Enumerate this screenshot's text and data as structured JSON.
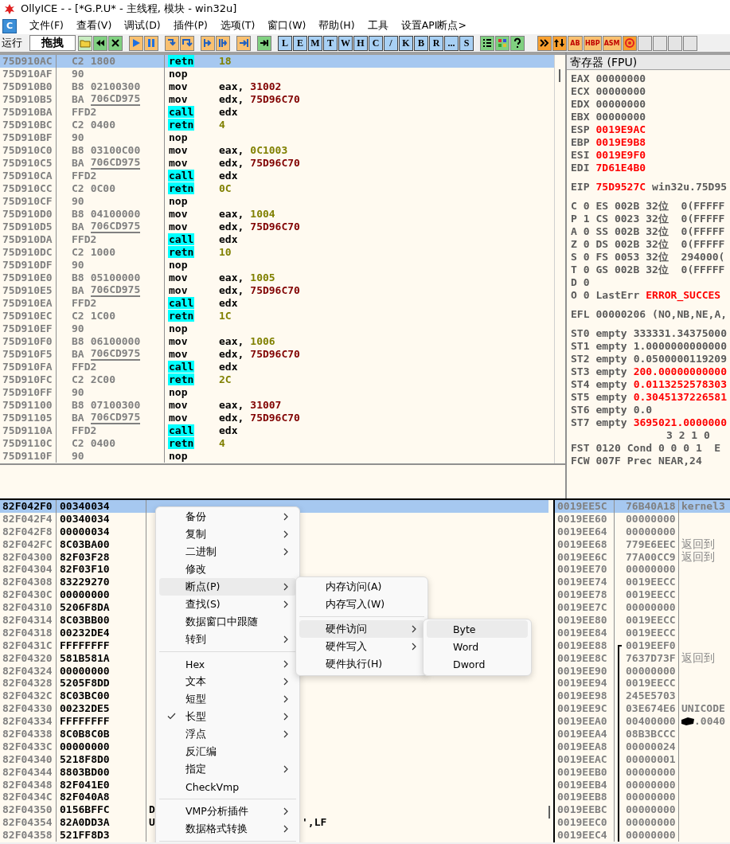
{
  "window": {
    "title": "OllyICE - - [*G.P.U* - 主线程, 模块 - win32u]"
  },
  "menu_bar": {
    "icon_letter": "C",
    "items": [
      "文件(F)",
      "查看(V)",
      "调试(D)",
      "插件(P)",
      "选项(T)",
      "窗口(W)",
      "帮助(H)",
      "工具",
      "设置API断点>"
    ]
  },
  "toolbar": {
    "run_label": "运行",
    "drag_button": "拖拽",
    "letter_buttons": [
      "L",
      "E",
      "M",
      "T",
      "W",
      "H",
      "C",
      "/",
      "K",
      "B",
      "R",
      "...",
      "S"
    ],
    "text_icons": [
      "AB",
      "HBP",
      "ASM"
    ]
  },
  "disassembly": {
    "rows": [
      {
        "address": "75D910AC",
        "hex": [
          "C2",
          "1800"
        ],
        "fixup": false,
        "kind": "retn",
        "mnemonic": "retn",
        "operand": "18",
        "color": "#808000",
        "selected": true
      },
      {
        "address": "75D910AF",
        "hex": [
          "90"
        ],
        "fixup": false,
        "kind": "plain",
        "mnemonic": "nop",
        "selected": false
      },
      {
        "address": "75D910B0",
        "hex": [
          "B8",
          "02100300"
        ],
        "fixup": false,
        "kind": "plain",
        "mnemonic": "mov",
        "register": "eax,",
        "operand": "31002",
        "color": "#800000",
        "selected": false
      },
      {
        "address": "75D910B5",
        "hex": [
          "BA",
          "706CD975"
        ],
        "fixup": true,
        "kind": "plain",
        "mnemonic": "mov",
        "register": "edx,",
        "operand": "75D96C70",
        "color": "#800000",
        "selected": false
      },
      {
        "address": "75D910BA",
        "hex": [
          "FFD2"
        ],
        "fixup": false,
        "kind": "call",
        "mnemonic": "call",
        "operand": "edx",
        "color": "#000000",
        "selected": false
      },
      {
        "address": "75D910BC",
        "hex": [
          "C2",
          "0400"
        ],
        "fixup": false,
        "kind": "retn",
        "mnemonic": "retn",
        "operand": "4",
        "color": "#808000",
        "selected": false
      },
      {
        "address": "75D910BF",
        "hex": [
          "90"
        ],
        "fixup": false,
        "kind": "plain",
        "mnemonic": "nop",
        "selected": false
      },
      {
        "address": "75D910C0",
        "hex": [
          "B8",
          "03100C00"
        ],
        "fixup": false,
        "kind": "plain",
        "mnemonic": "mov",
        "register": "eax,",
        "operand": "0C1003",
        "color": "#808000",
        "selected": false
      },
      {
        "address": "75D910C5",
        "hex": [
          "BA",
          "706CD975"
        ],
        "fixup": true,
        "kind": "plain",
        "mnemonic": "mov",
        "register": "edx,",
        "operand": "75D96C70",
        "color": "#800000",
        "selected": false
      },
      {
        "address": "75D910CA",
        "hex": [
          "FFD2"
        ],
        "fixup": false,
        "kind": "call",
        "mnemonic": "call",
        "operand": "edx",
        "color": "#000000",
        "selected": false
      },
      {
        "address": "75D910CC",
        "hex": [
          "C2",
          "0C00"
        ],
        "fixup": false,
        "kind": "retn",
        "mnemonic": "retn",
        "operand": "0C",
        "color": "#808000",
        "selected": false
      },
      {
        "address": "75D910CF",
        "hex": [
          "90"
        ],
        "fixup": false,
        "kind": "plain",
        "mnemonic": "nop",
        "selected": false
      },
      {
        "address": "75D910D0",
        "hex": [
          "B8",
          "04100000"
        ],
        "fixup": false,
        "kind": "plain",
        "mnemonic": "mov",
        "register": "eax,",
        "operand": "1004",
        "color": "#808000",
        "selected": false
      },
      {
        "address": "75D910D5",
        "hex": [
          "BA",
          "706CD975"
        ],
        "fixup": true,
        "kind": "plain",
        "mnemonic": "mov",
        "register": "edx,",
        "operand": "75D96C70",
        "color": "#800000",
        "selected": false
      },
      {
        "address": "75D910DA",
        "hex": [
          "FFD2"
        ],
        "fixup": false,
        "kind": "call",
        "mnemonic": "call",
        "operand": "edx",
        "color": "#000000",
        "selected": false
      },
      {
        "address": "75D910DC",
        "hex": [
          "C2",
          "1000"
        ],
        "fixup": false,
        "kind": "retn",
        "mnemonic": "retn",
        "operand": "10",
        "color": "#808000",
        "selected": false
      },
      {
        "address": "75D910DF",
        "hex": [
          "90"
        ],
        "fixup": false,
        "kind": "plain",
        "mnemonic": "nop",
        "selected": false
      },
      {
        "address": "75D910E0",
        "hex": [
          "B8",
          "05100000"
        ],
        "fixup": false,
        "kind": "plain",
        "mnemonic": "mov",
        "register": "eax,",
        "operand": "1005",
        "color": "#808000",
        "selected": false
      },
      {
        "address": "75D910E5",
        "hex": [
          "BA",
          "706CD975"
        ],
        "fixup": true,
        "kind": "plain",
        "mnemonic": "mov",
        "register": "edx,",
        "operand": "75D96C70",
        "color": "#800000",
        "selected": false
      },
      {
        "address": "75D910EA",
        "hex": [
          "FFD2"
        ],
        "fixup": false,
        "kind": "call",
        "mnemonic": "call",
        "operand": "edx",
        "color": "#000000",
        "selected": false
      },
      {
        "address": "75D910EC",
        "hex": [
          "C2",
          "1C00"
        ],
        "fixup": false,
        "kind": "retn",
        "mnemonic": "retn",
        "operand": "1C",
        "color": "#808000",
        "selected": false
      },
      {
        "address": "75D910EF",
        "hex": [
          "90"
        ],
        "fixup": false,
        "kind": "plain",
        "mnemonic": "nop",
        "selected": false
      },
      {
        "address": "75D910F0",
        "hex": [
          "B8",
          "06100000"
        ],
        "fixup": false,
        "kind": "plain",
        "mnemonic": "mov",
        "register": "eax,",
        "operand": "1006",
        "color": "#808000",
        "selected": false
      },
      {
        "address": "75D910F5",
        "hex": [
          "BA",
          "706CD975"
        ],
        "fixup": true,
        "kind": "plain",
        "mnemonic": "mov",
        "register": "edx,",
        "operand": "75D96C70",
        "color": "#800000",
        "selected": false
      },
      {
        "address": "75D910FA",
        "hex": [
          "FFD2"
        ],
        "fixup": false,
        "kind": "call",
        "mnemonic": "call",
        "operand": "edx",
        "color": "#000000",
        "selected": false
      },
      {
        "address": "75D910FC",
        "hex": [
          "C2",
          "2C00"
        ],
        "fixup": false,
        "kind": "retn",
        "mnemonic": "retn",
        "operand": "2C",
        "color": "#808000",
        "selected": false
      },
      {
        "address": "75D910FF",
        "hex": [
          "90"
        ],
        "fixup": false,
        "kind": "plain",
        "mnemonic": "nop",
        "selected": false
      },
      {
        "address": "75D91100",
        "hex": [
          "B8",
          "07100300"
        ],
        "fixup": false,
        "kind": "plain",
        "mnemonic": "mov",
        "register": "eax,",
        "operand": "31007",
        "color": "#800000",
        "selected": false
      },
      {
        "address": "75D91105",
        "hex": [
          "BA",
          "706CD975"
        ],
        "fixup": true,
        "kind": "plain",
        "mnemonic": "mov",
        "register": "edx,",
        "operand": "75D96C70",
        "color": "#800000",
        "selected": false
      },
      {
        "address": "75D9110A",
        "hex": [
          "FFD2"
        ],
        "fixup": false,
        "kind": "call",
        "mnemonic": "call",
        "operand": "edx",
        "color": "#000000",
        "selected": false
      },
      {
        "address": "75D9110C",
        "hex": [
          "C2",
          "0400"
        ],
        "fixup": false,
        "kind": "retn",
        "mnemonic": "retn",
        "operand": "4",
        "color": "#808000",
        "selected": false
      },
      {
        "address": "75D9110F",
        "hex": [
          "90"
        ],
        "fixup": false,
        "kind": "plain",
        "mnemonic": "nop",
        "selected": false
      }
    ]
  },
  "registers": {
    "title": "寄存器 (FPU)",
    "groups": [
      {
        "rows": [
          {
            "kind": "reg",
            "name": "EAX",
            "value": "00000000",
            "changed": false
          },
          {
            "kind": "reg",
            "name": "ECX",
            "value": "00000000",
            "changed": false
          },
          {
            "kind": "reg",
            "name": "EDX",
            "value": "00000000",
            "changed": false
          },
          {
            "kind": "reg",
            "name": "EBX",
            "value": "00000000",
            "changed": false
          },
          {
            "kind": "reg",
            "name": "ESP",
            "value": "0019E9AC",
            "changed": true
          },
          {
            "kind": "reg",
            "name": "EBP",
            "value": "0019E9B8",
            "changed": true
          },
          {
            "kind": "reg",
            "name": "ESI",
            "value": "0019E9F0",
            "changed": true
          },
          {
            "kind": "reg",
            "name": "EDI",
            "value": "7D61E4B0",
            "changed": true
          }
        ]
      },
      {
        "rows": [
          {
            "kind": "reg",
            "name": "EIP",
            "value": "75D9527C",
            "changed": true,
            "note": "win32u.75D95",
            "note_changed": false
          }
        ]
      },
      {
        "rows": [
          {
            "kind": "reg",
            "name": "C 0",
            "value": "ES 002B",
            "changed": false,
            "note": "32位  0(FFFFF",
            "note_changed": false
          },
          {
            "kind": "reg",
            "name": "P 1",
            "value": "CS 0023",
            "changed": false,
            "note": "32位  0(FFFFF",
            "note_changed": false
          },
          {
            "kind": "reg",
            "name": "A 0",
            "value": "SS 002B",
            "changed": false,
            "note": "32位  0(FFFFF",
            "note_changed": false
          },
          {
            "kind": "reg",
            "name": "Z 0",
            "value": "DS 002B",
            "changed": false,
            "note": "32位  0(FFFFF",
            "note_changed": false
          },
          {
            "kind": "reg",
            "name": "S 0",
            "value": "FS 0053",
            "changed": false,
            "note": "32位  294000(",
            "note_changed": false
          },
          {
            "kind": "reg",
            "name": "T 0",
            "value": "GS 002B",
            "changed": false,
            "note": "32位  0(FFFFF",
            "note_changed": false
          },
          {
            "kind": "reg",
            "name": "D 0"
          },
          {
            "kind": "reg",
            "name": "O 0",
            "value": "LastErr",
            "changed": false,
            "note": "ERROR_SUCCES",
            "note_changed": true
          }
        ]
      },
      {
        "rows": [
          {
            "kind": "reg",
            "name": "EFL",
            "value": "00000206",
            "changed": false,
            "note": "(NO,NB,NE,A,",
            "note_changed": false
          }
        ]
      },
      {
        "rows": [
          {
            "kind": "reg",
            "name": "ST0",
            "value": "empty",
            "changed": false,
            "note": "333331.34375000",
            "note_changed": false
          },
          {
            "kind": "reg",
            "name": "ST1",
            "value": "empty",
            "changed": false,
            "note": "1.0000000000000",
            "note_changed": false
          },
          {
            "kind": "reg",
            "name": "ST2",
            "value": "empty",
            "changed": false,
            "note": "0.0500000119209",
            "note_changed": false
          },
          {
            "kind": "reg",
            "name": "ST3",
            "value": "empty",
            "changed": false,
            "note": "200.00000000000",
            "note_changed": true
          },
          {
            "kind": "reg",
            "name": "ST4",
            "value": "empty",
            "changed": false,
            "note": "0.0113252578303",
            "note_changed": true
          },
          {
            "kind": "reg",
            "name": "ST5",
            "value": "empty",
            "changed": false,
            "note": "0.3045137226581",
            "note_changed": true
          },
          {
            "kind": "reg",
            "name": "ST6",
            "value": "empty",
            "changed": false,
            "note": "0.0",
            "note_changed": false
          },
          {
            "kind": "reg",
            "name": "ST7",
            "value": "empty",
            "changed": false,
            "note": "3695021.0000000",
            "note_changed": true
          },
          {
            "kind": "digits",
            "note": "3 2 1 0"
          },
          {
            "kind": "reg",
            "name": "FST",
            "value": "0120",
            "changed": false,
            "note": "Cond 0 0 0 1  E",
            "note_changed": false
          },
          {
            "kind": "reg",
            "name": "FCW",
            "value": "007F",
            "changed": false,
            "note": "Prec NEAR,24",
            "note_changed": false
          }
        ]
      }
    ]
  },
  "dump": {
    "rows": [
      {
        "address": "82F042F0",
        "value": "00340034",
        "selected": true
      },
      {
        "address": "82F042F4",
        "value": "00340034",
        "selected": false
      },
      {
        "address": "82F042F8",
        "value": "00000034",
        "selected": false
      },
      {
        "address": "82F042FC",
        "value": "8C03BA00",
        "selected": false
      },
      {
        "address": "82F04300",
        "value": "82F03F28",
        "selected": false
      },
      {
        "address": "82F04304",
        "value": "82F03F10",
        "selected": false
      },
      {
        "address": "82F04308",
        "value": "83229270",
        "selected": false
      },
      {
        "address": "82F0430C",
        "value": "00000000",
        "selected": false
      },
      {
        "address": "82F04310",
        "value": "5206F8DA",
        "selected": false
      },
      {
        "address": "82F04314",
        "value": "8C03BB00",
        "selected": false
      },
      {
        "address": "82F04318",
        "value": "00232DE4",
        "selected": false
      },
      {
        "address": "82F0431C",
        "value": "FFFFFFFF",
        "selected": false
      },
      {
        "address": "82F04320",
        "value": "581B581A",
        "selected": false
      },
      {
        "address": "82F04324",
        "value": "00000000",
        "selected": false
      },
      {
        "address": "82F04328",
        "value": "5205F8DD",
        "selected": false
      },
      {
        "address": "82F0432C",
        "value": "8C03BC00",
        "selected": false
      },
      {
        "address": "82F04330",
        "value": "00232DE5",
        "selected": false
      },
      {
        "address": "82F04334",
        "value": "FFFFFFFF",
        "selected": false
      },
      {
        "address": "82F04338",
        "value": "8C0B8C0B",
        "selected": false
      },
      {
        "address": "82F0433C",
        "value": "00000000",
        "selected": false
      },
      {
        "address": "82F04340",
        "value": "5218F8D0",
        "selected": false
      },
      {
        "address": "82F04344",
        "value": "8803BD00",
        "selected": false
      },
      {
        "address": "82F04348",
        "value": "82F041E0",
        "selected": false
      },
      {
        "address": "82F0434C",
        "value": "82F040A8",
        "selected": false
      },
      {
        "address": "82F04350",
        "value": "0156BFFC",
        "column_3": "D",
        "selected": false
      },
      {
        "address": "82F04354",
        "value": "82A0DD3A",
        "column_3": "U",
        "column_3_tail": "',LF",
        "selected": false
      },
      {
        "address": "82F04358",
        "value": "521FF8D3",
        "selected": false
      }
    ]
  },
  "stack": {
    "rows": [
      {
        "address": "0019EE5C",
        "value": "76B40A18",
        "comment": "kernel3",
        "frame": false,
        "selected": true
      },
      {
        "address": "0019EE60",
        "value": "00000000",
        "frame": false,
        "selected": false
      },
      {
        "address": "0019EE64",
        "value": "00000000",
        "frame": false,
        "selected": false
      },
      {
        "address": "0019EE68",
        "value": "779E6EEC",
        "comment": "返回到",
        "frame": false,
        "selected": false
      },
      {
        "address": "0019EE6C",
        "value": "77A00CC9",
        "comment": "返回到",
        "frame": false,
        "selected": false
      },
      {
        "address": "0019EE70",
        "value": "00000000",
        "frame": false,
        "selected": false
      },
      {
        "address": "0019EE74",
        "value": "0019EECC",
        "frame": false,
        "selected": false
      },
      {
        "address": "0019EE78",
        "value": "0019EECC",
        "frame": false,
        "selected": false
      },
      {
        "address": "0019EE7C",
        "value": "00000000",
        "frame": false,
        "selected": false
      },
      {
        "address": "0019EE80",
        "value": "0019EECC",
        "frame": false,
        "selected": false
      },
      {
        "address": "0019EE84",
        "value": "0019EECC",
        "frame": false,
        "selected": false
      },
      {
        "address": "0019EE88",
        "value": "0019EEF0",
        "frame": true,
        "selected": false
      },
      {
        "address": "0019EE8C",
        "value": "7637D73F",
        "comment": "返回到",
        "frame": true,
        "selected": false
      },
      {
        "address": "0019EE90",
        "value": "00000000",
        "frame": true,
        "selected": false
      },
      {
        "address": "0019EE94",
        "value": "0019EECC",
        "frame": true,
        "selected": false
      },
      {
        "address": "0019EE98",
        "value": "245E5703",
        "frame": true,
        "selected": false
      },
      {
        "address": "0019EE9C",
        "value": "03E674E6",
        "comment": "UNICODE",
        "frame": true,
        "selected": false
      },
      {
        "address": "0019EEA0",
        "value": "00400000",
        "comment": ".0040",
        "redacted_prefix": true,
        "frame": true,
        "selected": false
      },
      {
        "address": "0019EEA4",
        "value": "08B3BCCC",
        "frame": true,
        "selected": false
      },
      {
        "address": "0019EEA8",
        "value": "00000024",
        "frame": true,
        "selected": false
      },
      {
        "address": "0019EEAC",
        "value": "00000001",
        "frame": true,
        "selected": false
      },
      {
        "address": "0019EEB0",
        "value": "00000000",
        "frame": true,
        "selected": false
      },
      {
        "address": "0019EEB4",
        "value": "00000000",
        "frame": true,
        "selected": false
      },
      {
        "address": "0019EEB8",
        "value": "00000000",
        "frame": true,
        "selected": false
      },
      {
        "address": "0019EEBC",
        "value": "00000000",
        "frame": true,
        "selected": false
      },
      {
        "address": "0019EEC0",
        "value": "00000000",
        "frame": true,
        "selected": false
      },
      {
        "address": "0019EEC4",
        "value": "00000000",
        "frame": true,
        "selected": false
      }
    ]
  },
  "context_menus": [
    {
      "items": [
        {
          "kind": "item",
          "label": "备份",
          "submenu": true,
          "checked": false,
          "selected": false
        },
        {
          "kind": "item",
          "label": "复制",
          "submenu": true,
          "checked": false,
          "selected": false
        },
        {
          "kind": "item",
          "label": "二进制",
          "submenu": true,
          "checked": false,
          "selected": false
        },
        {
          "kind": "item",
          "label": "修改",
          "submenu": false,
          "checked": false,
          "selected": false
        },
        {
          "kind": "item",
          "label": "断点(P)",
          "submenu": true,
          "checked": false,
          "selected": true
        },
        {
          "kind": "item",
          "label": "查找(S)",
          "submenu": true,
          "checked": false,
          "selected": false
        },
        {
          "kind": "item",
          "label": "数据窗口中跟随",
          "submenu": false,
          "checked": false,
          "selected": false
        },
        {
          "kind": "item",
          "label": "转到",
          "submenu": true,
          "checked": false,
          "selected": false
        },
        {
          "kind": "separator"
        },
        {
          "kind": "item",
          "label": "Hex",
          "submenu": true,
          "checked": false,
          "selected": false
        },
        {
          "kind": "item",
          "label": "文本",
          "submenu": true,
          "checked": false,
          "selected": false
        },
        {
          "kind": "item",
          "label": "短型",
          "submenu": true,
          "checked": false,
          "selected": false
        },
        {
          "kind": "item",
          "label": "长型",
          "submenu": true,
          "checked": true,
          "selected": false
        },
        {
          "kind": "item",
          "label": "浮点",
          "submenu": true,
          "checked": false,
          "selected": false
        },
        {
          "kind": "item",
          "label": "反汇编",
          "submenu": false,
          "checked": false,
          "selected": false
        },
        {
          "kind": "item",
          "label": "指定",
          "submenu": true,
          "checked": false,
          "selected": false
        },
        {
          "kind": "item",
          "label": "CheckVmp",
          "submenu": false,
          "checked": false,
          "selected": false
        },
        {
          "kind": "separator"
        },
        {
          "kind": "item",
          "label": "VMP分析插件",
          "submenu": true,
          "checked": false,
          "selected": false
        },
        {
          "kind": "item",
          "label": "数据格式转换",
          "submenu": true,
          "checked": false,
          "selected": false
        },
        {
          "kind": "separator"
        }
      ]
    },
    {
      "items": [
        {
          "kind": "item",
          "label": "内存访问(A)",
          "submenu": false,
          "checked": false,
          "selected": false
        },
        {
          "kind": "item",
          "label": "内存写入(W)",
          "submenu": false,
          "checked": false,
          "selected": false
        },
        {
          "kind": "separator"
        },
        {
          "kind": "item",
          "label": "硬件访问",
          "submenu": true,
          "checked": false,
          "selected": true
        },
        {
          "kind": "item",
          "label": "硬件写入",
          "submenu": true,
          "checked": false,
          "selected": false
        },
        {
          "kind": "item",
          "label": "硬件执行(H)",
          "submenu": false,
          "checked": false,
          "selected": false
        }
      ]
    },
    {
      "items": [
        {
          "kind": "item",
          "label": "Byte",
          "submenu": false,
          "checked": false,
          "selected": true
        },
        {
          "kind": "item",
          "label": "Word",
          "submenu": false,
          "checked": false,
          "selected": false
        },
        {
          "kind": "item",
          "label": "Dword",
          "submenu": false,
          "checked": false,
          "selected": false
        }
      ]
    }
  ]
}
